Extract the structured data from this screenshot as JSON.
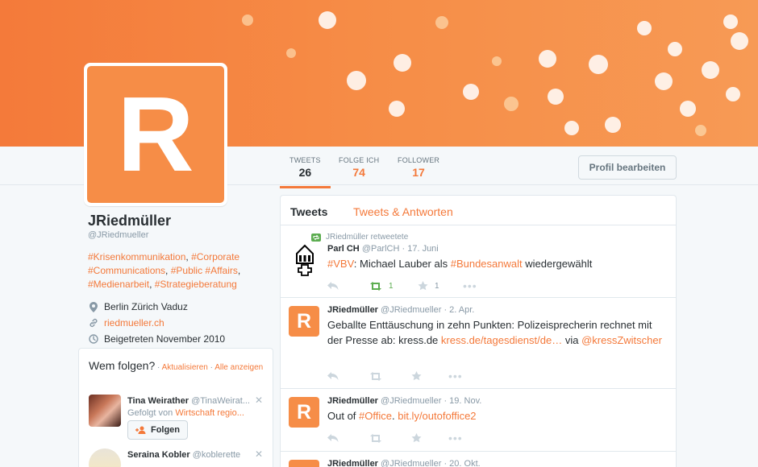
{
  "colors": {
    "accent": "#f4793a",
    "banner": "#f68d47",
    "retweet_green": "#5cad50",
    "muted": "#8899a6"
  },
  "nav": {
    "items": [
      {
        "label": "TWEETS",
        "value": "26"
      },
      {
        "label": "FOLGE ICH",
        "value": "74"
      },
      {
        "label": "FOLLOWER",
        "value": "17"
      }
    ],
    "edit_profile": "Profil bearbeiten"
  },
  "profile": {
    "avatar_letter": "R",
    "name": "JRiedmüller",
    "handle": "@JRiedmueller",
    "bio": {
      "line1_a": "#Krisenkommunikation",
      "line1_sep": ", ",
      "line1_b": "#Corporate",
      "line2_a": "#Communications",
      "line2_sep": ", ",
      "line2_b": "#Public",
      "line2_c": "#Affairs",
      "line2_end": ",",
      "line3_a": "#Medienarbeit",
      "line3_sep": ", ",
      "line3_b": "#Strategieberatung"
    },
    "location": "Berlin Zürich Vaduz",
    "website": "riedmueller.ch",
    "joined": "Beigetreten November 2010",
    "icons": [
      "location-pin-icon",
      "link-icon",
      "calendar-clock-icon"
    ]
  },
  "who_to_follow": {
    "title": "Wem folgen?",
    "dot": " · ",
    "refresh": "Aktualisieren",
    "all": "Alle anzeigen",
    "users": [
      {
        "name": "Tina Weirather",
        "handle": "@TinaWeirat...",
        "followed_by_prefix": "Gefolgt von",
        "followed_by": "Wirtschaft regio...",
        "follow_label": "Folgen"
      },
      {
        "name": "Seraina Kobler",
        "handle": "@koblerette"
      }
    ]
  },
  "timeline": {
    "tabs": [
      "Tweets",
      "Tweets & Antworten"
    ],
    "tweets": [
      {
        "retweeted_by": "JRiedmüller retweetete",
        "author": "Parl CH",
        "handle": "@ParlCH",
        "date": "· 17. Juni",
        "text": {
          "h1": "#VBV",
          "t1": ": Michael Lauber als ",
          "h2": "#Bundesanwalt",
          "t2": " wiedergewählt"
        },
        "retweets": "1",
        "favorites": "1"
      },
      {
        "author": "JRiedmüller",
        "handle": "@JRiedmueller",
        "date": "· 2. Apr.",
        "text": {
          "t1": "Geballte Enttäuschung in zehn Punkten: Polizeisprecherin rechnet mit der Presse ab: kress.de ",
          "l1": "kress.de/tagesdienst/de…",
          "t2": " via ",
          "l2": "@kressZwitscher"
        }
      },
      {
        "author": "JRiedmüller",
        "handle": "@JRiedmueller",
        "date": "· 19. Nov.",
        "text": {
          "t1": "Out of ",
          "h1": "#Office",
          "t2": ". ",
          "l1": "bit.ly/outofoffice2"
        }
      },
      {
        "author": "JRiedmüller",
        "handle": "@JRiedmueller",
        "date": "· 20. Okt."
      }
    ]
  }
}
